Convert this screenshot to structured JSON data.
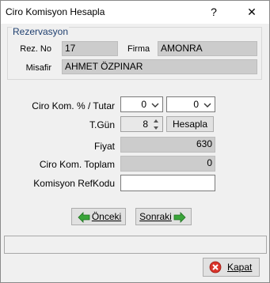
{
  "window": {
    "title": "Ciro Komisyon Hesapla",
    "help_label": "?",
    "close_label": "✕"
  },
  "reservation": {
    "group_label": "Rezervasyon",
    "rez_no_label": "Rez. No",
    "rez_no_value": "17",
    "firma_label": "Firma",
    "firma_value": "AMONRA",
    "misafir_label": "Misafir",
    "misafir_value": "AHMET ÖZPINAR"
  },
  "form": {
    "ciro_label": "Ciro Kom. % / Tutar",
    "ciro_pct_value": "0",
    "ciro_amount_value": "0",
    "tgun_label": "T.Gün",
    "tgun_value": "8",
    "hesapla_label": "Hesapla",
    "fiyat_label": "Fiyat",
    "fiyat_value": "630",
    "toplam_label": "Ciro Kom. Toplam",
    "toplam_value": "0",
    "refkodu_label": "Komisyon RefKodu",
    "refkodu_value": ""
  },
  "nav": {
    "prev_label": "Önceki",
    "next_label": "Sonraki",
    "prev_icon": "arrow-left-icon",
    "next_icon": "arrow-right-icon"
  },
  "status": {
    "text": ""
  },
  "footer": {
    "kapat_label": "Kapat",
    "kapat_icon": "close-icon"
  }
}
